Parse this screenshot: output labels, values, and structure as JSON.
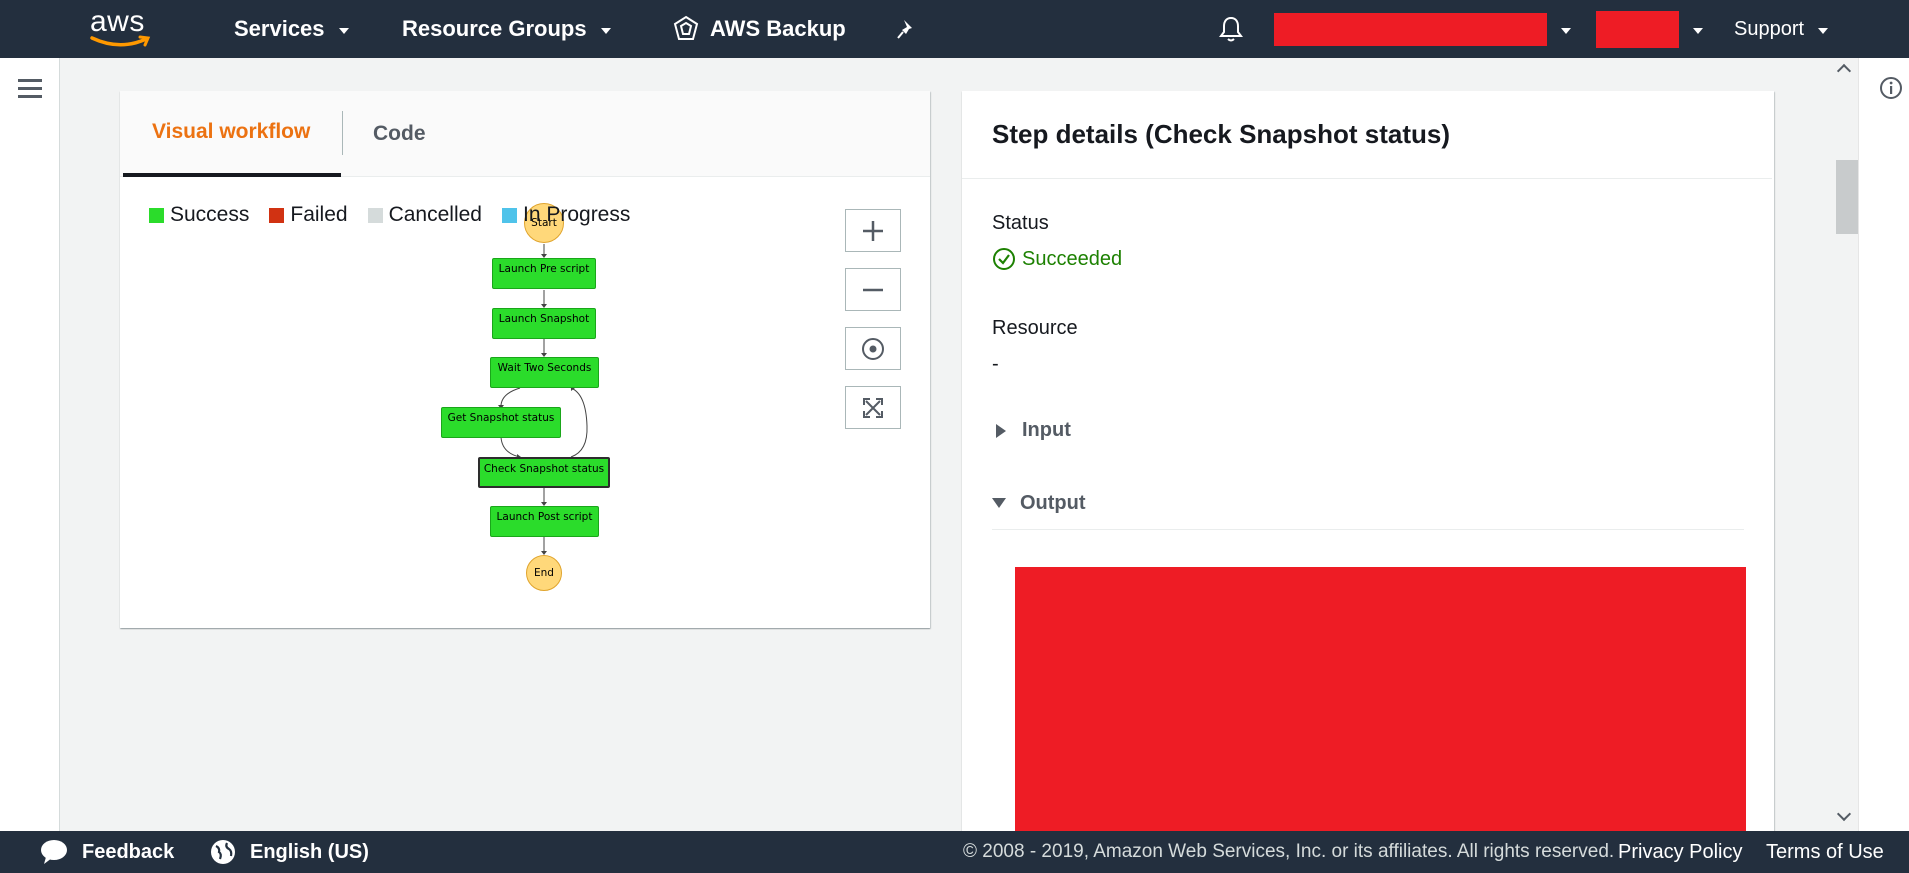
{
  "topbar": {
    "logo": "aws",
    "services_label": "Services",
    "resource_groups_label": "Resource Groups",
    "service_shortcut_label": "AWS Backup",
    "support_label": "Support"
  },
  "tabs": {
    "visual_workflow": "Visual workflow",
    "code": "Code"
  },
  "legend": [
    {
      "label": "Success",
      "color": "#2bdc2b"
    },
    {
      "label": "Failed",
      "color": "#d13212"
    },
    {
      "label": "Cancelled",
      "color": "#d5dbdb"
    },
    {
      "label": "In Progress",
      "color": "#4fc3ea"
    }
  ],
  "workflow": {
    "start": "Start",
    "end": "End",
    "steps": {
      "launch_pre": "Launch Pre script",
      "launch_snapshot": "Launch Snapshot",
      "wait": "Wait Two Seconds",
      "get_status": "Get Snapshot status",
      "check_status": "Check Snapshot status",
      "launch_post": "Launch Post script"
    }
  },
  "details": {
    "title": "Step details (Check Snapshot status)",
    "status_label": "Status",
    "status_value": "Succeeded",
    "resource_label": "Resource",
    "resource_value": "-",
    "input_label": "Input",
    "output_label": "Output"
  },
  "footer": {
    "feedback": "Feedback",
    "language": "English (US)",
    "copyright": "© 2008 - 2019, Amazon Web Services, Inc. or its affiliates. All rights reserved.",
    "privacy": "Privacy Policy",
    "terms": "Terms of Use"
  },
  "colors": {
    "header_bg": "#232f3e",
    "accent": "#ec7211",
    "success": "#1d8102",
    "node_fill": "#2bdc2b",
    "redaction": "#ee1c25"
  }
}
